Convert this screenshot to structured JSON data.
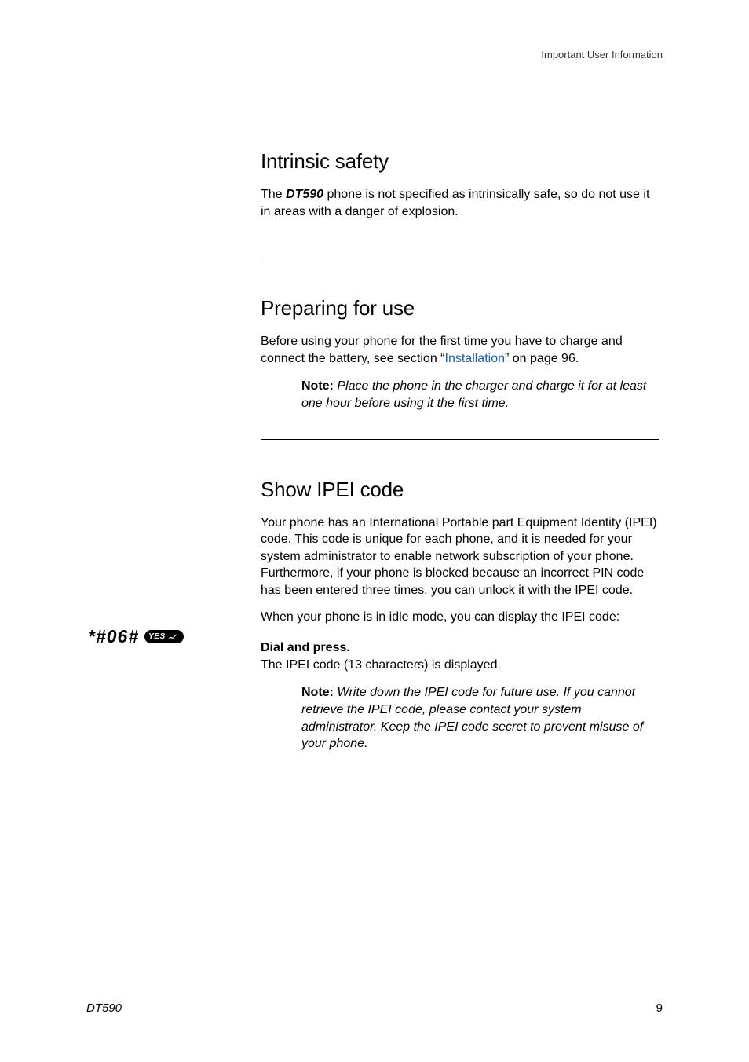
{
  "header": {
    "section_name": "Important User Information"
  },
  "sections": {
    "intrinsic": {
      "heading": "Intrinsic safety",
      "text_before": "The ",
      "product": "DT590",
      "text_after": " phone is not specified as intrinsically safe, so do not use it in areas with a danger of explosion."
    },
    "preparing": {
      "heading": "Preparing for use",
      "text_before": "Before using your phone for the first time you have to charge and connect the battery, see section “",
      "link_text": "Installation",
      "text_after": "” on page 96.",
      "note_label": "Note:",
      "note_text": "Place the phone in the charger and charge it for at least one hour before using it the first time."
    },
    "ipei": {
      "heading": "Show IPEI code",
      "para1": "Your phone has an International Portable part Equipment Identity (IPEI) code. This code is unique for each phone, and it is needed for your system administrator to enable network subscription of your phone. Furthermore, if your phone is blocked because an incorrect PIN code has been entered three times, you can unlock it with the IPEI code.",
      "para2": "When your phone is in idle mode, you can display the IPEI code:",
      "dial_code": "*#06#",
      "yes_label": "YES",
      "instruction_bold": "Dial and press.",
      "instruction_text": "The IPEI code (13 characters) is displayed.",
      "note_label": "Note:",
      "note_text": "Write down the IPEI code for future use. If you cannot retrieve the IPEI code, please contact your system administrator. Keep the IPEI code secret to prevent misuse of your phone."
    }
  },
  "footer": {
    "product": "DT590",
    "page_number": "9"
  }
}
